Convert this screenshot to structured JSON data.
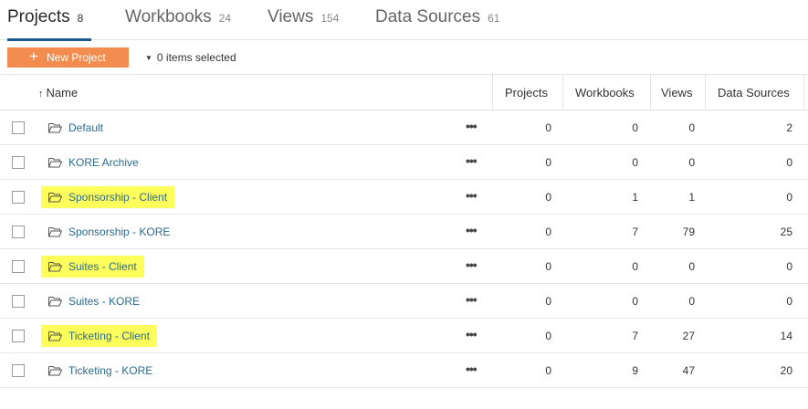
{
  "tabs": [
    {
      "label": "Projects",
      "count": "8"
    },
    {
      "label": "Workbooks",
      "count": "24"
    },
    {
      "label": "Views",
      "count": "154"
    },
    {
      "label": "Data Sources",
      "count": "61"
    }
  ],
  "toolbar": {
    "new_project_label": "New Project",
    "selection_text": "0 items selected"
  },
  "columns": {
    "name": "Name",
    "projects": "Projects",
    "workbooks": "Workbooks",
    "views": "Views",
    "data_sources": "Data Sources"
  },
  "colors": {
    "accent_button": "#f28c4f",
    "active_tab_underline": "#1f5a8c",
    "highlight": "#ffff5c",
    "link": "#2d6a8a"
  },
  "rows": [
    {
      "name": "Default",
      "projects": "0",
      "workbooks": "0",
      "views": "0",
      "data_sources": "2",
      "highlighted": false
    },
    {
      "name": "KORE Archive",
      "projects": "0",
      "workbooks": "0",
      "views": "0",
      "data_sources": "0",
      "highlighted": false
    },
    {
      "name": "Sponsorship - Client",
      "projects": "0",
      "workbooks": "1",
      "views": "1",
      "data_sources": "0",
      "highlighted": true
    },
    {
      "name": "Sponsorship - KORE",
      "projects": "0",
      "workbooks": "7",
      "views": "79",
      "data_sources": "25",
      "highlighted": false
    },
    {
      "name": "Suites - Client",
      "projects": "0",
      "workbooks": "0",
      "views": "0",
      "data_sources": "0",
      "highlighted": true
    },
    {
      "name": "Suites - KORE",
      "projects": "0",
      "workbooks": "0",
      "views": "0",
      "data_sources": "0",
      "highlighted": false
    },
    {
      "name": "Ticketing - Client",
      "projects": "0",
      "workbooks": "7",
      "views": "27",
      "data_sources": "14",
      "highlighted": true
    },
    {
      "name": "Ticketing - KORE",
      "projects": "0",
      "workbooks": "9",
      "views": "47",
      "data_sources": "20",
      "highlighted": false
    }
  ]
}
